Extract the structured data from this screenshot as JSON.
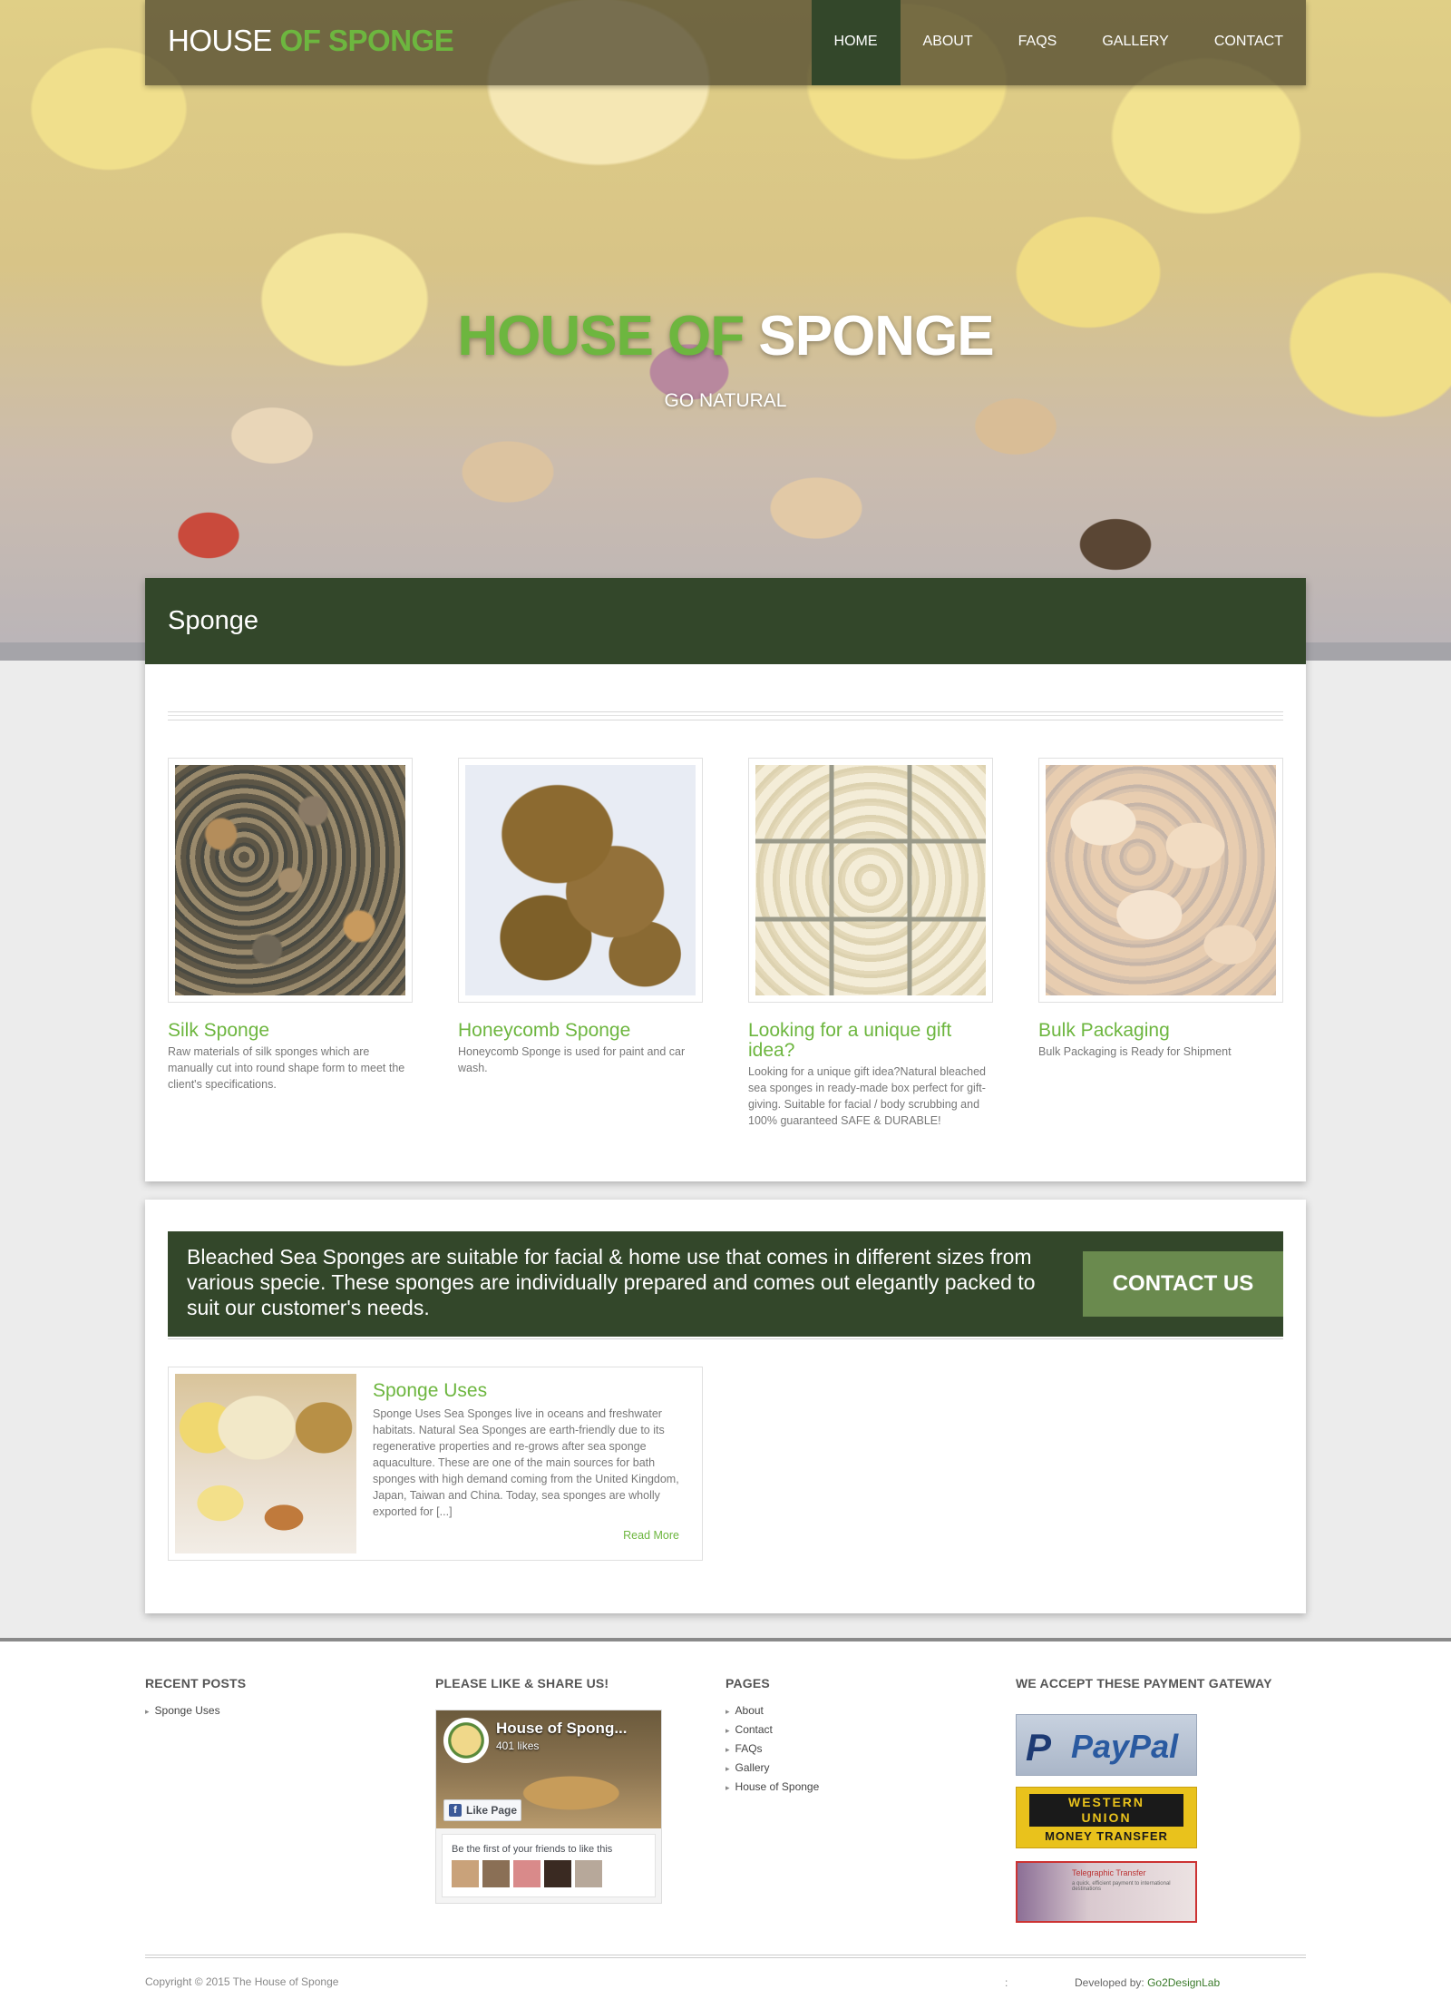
{
  "brand": {
    "light": "HOUSE",
    "bold": "OF SPONGE"
  },
  "nav": [
    {
      "label": "HOME",
      "active": true
    },
    {
      "label": "ABOUT",
      "active": false
    },
    {
      "label": "FAQS",
      "active": false
    },
    {
      "label": "GALLERY",
      "active": false
    },
    {
      "label": "CONTACT",
      "active": false
    }
  ],
  "hero": {
    "title_green": "HOUSE OF",
    "title_white": "SPONGE",
    "subtitle": "GO NATURAL"
  },
  "section1": {
    "heading": "Sponge",
    "products": [
      {
        "title": "Silk Sponge",
        "desc": "Raw materials of silk sponges which are manually cut into round shape form to meet the client's specifications."
      },
      {
        "title": "Honeycomb Sponge",
        "desc": "Honeycomb Sponge is used for paint and car wash."
      },
      {
        "title": "Looking for a unique gift idea?",
        "desc": "Looking for a unique gift idea?Natural bleached sea sponges in ready-made box perfect for gift-giving. Suitable for facial / body scrubbing and 100% guaranteed SAFE & DURABLE!"
      },
      {
        "title": "Bulk Packaging",
        "desc": "Bulk Packaging is Ready for Shipment"
      }
    ]
  },
  "cta": {
    "text": "Bleached Sea Sponges are suitable for facial & home use that comes in different sizes from various specie. These sponges are individually prepared and comes out elegantly packed to suit our customer's needs.",
    "button": "CONTACT US"
  },
  "post": {
    "title": "Sponge Uses",
    "excerpt": "Sponge Uses Sea Sponges live in oceans and freshwater habitats. Natural Sea Sponges are earth-friendly due to its regenerative properties and re-grows after sea sponge aquaculture. These are one of the main sources for bath sponges with high demand coming from the United Kingdom, Japan, Taiwan and China. Today, sea sponges are wholly exported for [...]",
    "read_more": "Read More"
  },
  "footer": {
    "recent_posts": {
      "heading": "RECENT POSTS",
      "items": [
        "Sponge Uses"
      ]
    },
    "social": {
      "heading": "PLEASE LIKE & SHARE US!",
      "page_name": "House of Spong...",
      "likes": "401 likes",
      "like_button": "Like Page",
      "friends_text": "Be the first of your friends to like this"
    },
    "pages": {
      "heading": "PAGES",
      "items": [
        "About",
        "Contact",
        "FAQs",
        "Gallery",
        "House of Sponge"
      ]
    },
    "payment": {
      "heading": "WE ACCEPT THESE PAYMENT GATEWAY",
      "paypal": "PayPal",
      "wu_line1": "WESTERN",
      "wu_line2": "UNION",
      "wu_sub": "MONEY TRANSFER",
      "tt_title": "Telegraphic Transfer",
      "tt_sub": "a quick, efficient payment to international destinations"
    },
    "copyright": "Copyright © 2015 The House of Sponge",
    "separator": ":",
    "developed_label": "Developed by:",
    "developed_by": "Go2DesignLab"
  },
  "colors": {
    "accent_green": "#6db63f",
    "dark_green": "#33472a"
  }
}
